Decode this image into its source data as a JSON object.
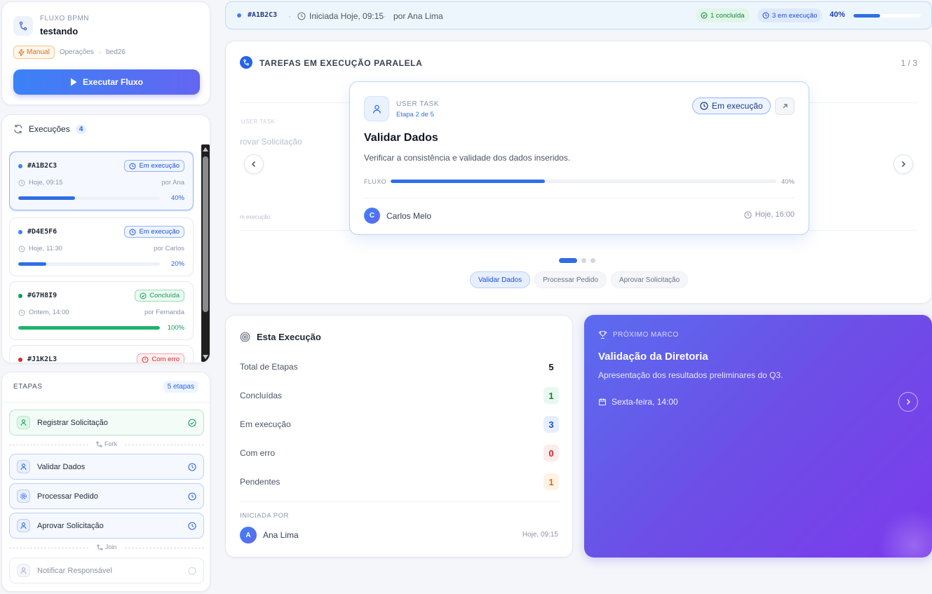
{
  "flow": {
    "kicker": "FLUXO BPMN",
    "name": "testando",
    "trigger": "Manual",
    "category": "Operações",
    "code": "bed26",
    "run_label": "Executar Fluxo"
  },
  "executions": {
    "title": "Execuções",
    "count": "4",
    "items": [
      {
        "id": "#A1B2C3",
        "status": "Em execução",
        "when": "Hoje, 09:15",
        "by": "por Ana",
        "pct": "40%",
        "progress": 40
      },
      {
        "id": "#D4E5F6",
        "status": "Em execução",
        "when": "Hoje, 11:30",
        "by": "por Carlos",
        "pct": "20%",
        "progress": 20
      },
      {
        "id": "#G7H8I9",
        "status": "Concluída",
        "when": "Ontem, 14:00",
        "by": "por Fernanda",
        "pct": "100%",
        "progress": 100
      },
      {
        "id": "#J1K2L3",
        "status": "Com erro",
        "when": "",
        "by": "",
        "pct": "",
        "progress": 0
      }
    ]
  },
  "steps": {
    "title": "ETAPAS",
    "count": "5 etapas",
    "fork_label": "Fork",
    "join_label": "Join",
    "items": [
      {
        "label": "Registrar Solicitação",
        "state": "done"
      },
      {
        "label": "Validar Dados",
        "state": "running"
      },
      {
        "label": "Processar Pedido",
        "state": "running"
      },
      {
        "label": "Aprovar Solicitação",
        "state": "running"
      },
      {
        "label": "Notificar Responsável",
        "state": "pending"
      }
    ]
  },
  "topbar": {
    "id": "#A1B2C3",
    "started": "Iniciada Hoje, 09:15",
    "by": "por Ana Lima",
    "done_badge": "1 concluída",
    "running_badge": "3 em execução",
    "pct": "40%",
    "progress": 40
  },
  "tasks": {
    "title": "TAREFAS EM EXECUÇÃO PARALELA",
    "pager": "1 / 3",
    "ghost": {
      "kicker": "USER TASK",
      "title": "rovar Solicitação",
      "status": "m execução"
    },
    "current": {
      "kicker": "USER TASK",
      "stage": "Etapa 2 de 5",
      "status": "Em execução",
      "title": "Validar Dados",
      "description": "Verificar a consistência e validade dos dados inseridos.",
      "flow_label": "FLUXO",
      "pct": "40%",
      "progress": 40,
      "assignee_initial": "C",
      "assignee": "Carlos Melo",
      "due": "Hoje, 16:00"
    },
    "chips": [
      "Validar Dados",
      "Processar Pedido",
      "Aprovar Solicitação"
    ]
  },
  "this_execution": {
    "title": "Esta Execução",
    "stats": [
      {
        "label": "Total de Etapas",
        "value": "5",
        "kind": "total"
      },
      {
        "label": "Concluídas",
        "value": "1",
        "kind": "done"
      },
      {
        "label": "Em execução",
        "value": "3",
        "kind": "run"
      },
      {
        "label": "Com erro",
        "value": "0",
        "kind": "err"
      },
      {
        "label": "Pendentes",
        "value": "1",
        "kind": "pend"
      }
    ],
    "started_kicker": "INICIADA POR",
    "started_initial": "A",
    "started_name": "Ana Lima",
    "started_time": "Hoje, 09:15"
  },
  "milestone": {
    "kicker": "PRÓXIMO MARCO",
    "title": "Validação da Diretoria",
    "description": "Apresentação dos resultados preliminares do Q3.",
    "when": "Sexta-feira, 14:00"
  },
  "colors": {
    "accent": "#2f6fe6",
    "success": "#0f9d58",
    "error": "#dc2626",
    "warning": "#ea6a0a",
    "milestone_gradient_start": "#5b6cf0",
    "milestone_gradient_end": "#7c3aed"
  }
}
